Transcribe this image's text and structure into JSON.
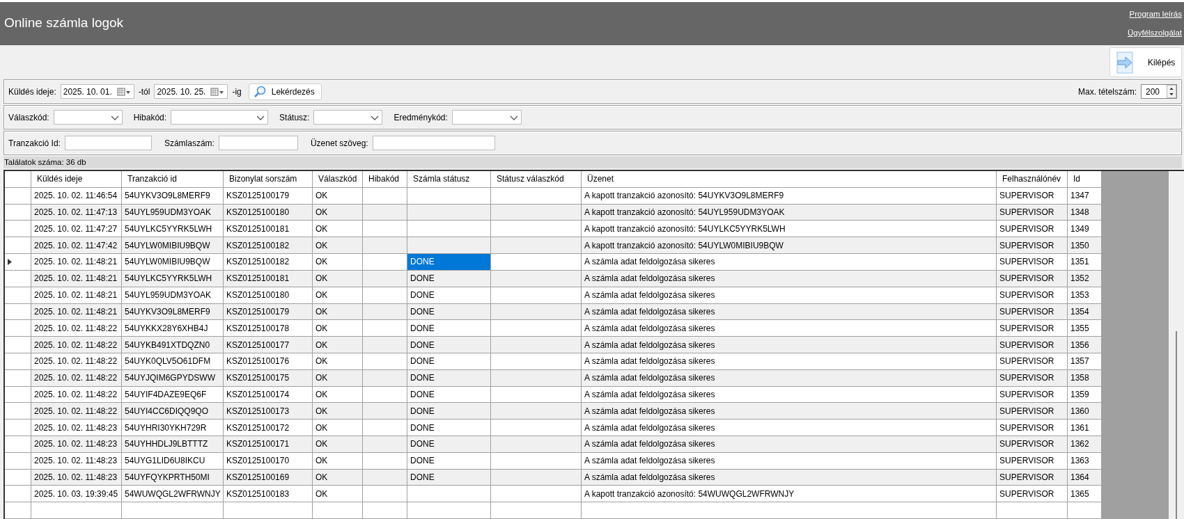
{
  "header": {
    "title": "Online számla logok",
    "links": [
      "Program leírás",
      "Ügyfélszolgálat"
    ]
  },
  "exit_button": {
    "label": "Kilépés"
  },
  "filters": {
    "sent_label": "Küldés ideje:",
    "date_from": "2025. 10. 01.",
    "from_suffix": "-tól",
    "date_to": "2025. 10. 25.",
    "to_suffix": "-ig",
    "query_button": "Lekérdezés",
    "max_label": "Max. tételszám:",
    "max_value": "200",
    "combos": [
      {
        "label": "Válaszkód:"
      },
      {
        "label": "Hibakód:"
      },
      {
        "label": "Státusz:"
      },
      {
        "label": "Eredménykód:"
      }
    ],
    "text_fields": [
      {
        "label": "Tranzakció Id:"
      },
      {
        "label": "Számlaszám:"
      },
      {
        "label": "Üzenet szöveg:"
      }
    ]
  },
  "result_count": "Találatok száma: 36 db",
  "table": {
    "columns": [
      "Küldés ideje",
      "Tranzakció id",
      "Bizonylat sorszám",
      "Válaszkód",
      "Hibakód",
      "Számla státusz",
      "Státusz válaszkód",
      "Üzenet",
      "Felhasználónév",
      "Id"
    ],
    "rows": [
      {
        "kuldes_ideje": "2025. 10. 02. 11:46:54",
        "tranzakcio_id": "54UYKV3O9L8MERF9",
        "bizonylat_sorszam": "KSZ0125100179",
        "valaszkod": "OK",
        "uzenet": "A kapott tranzakció azonosító: 54UYKV3O9L8MERF9",
        "felhasznalonev": "SUPERVISOR",
        "id": "1347",
        "selected": false
      },
      {
        "kuldes_ideje": "2025. 10. 02. 11:47:13",
        "tranzakcio_id": "54UYL959UDM3YOAK",
        "bizonylat_sorszam": "KSZ0125100180",
        "valaszkod": "OK",
        "uzenet": "A kapott tranzakció azonosító: 54UYL959UDM3YOAK",
        "felhasznalonev": "SUPERVISOR",
        "id": "1348",
        "selected": false
      },
      {
        "kuldes_ideje": "2025. 10. 02. 11:47:27",
        "tranzakcio_id": "54UYLKC5YYRK5LWH",
        "bizonylat_sorszam": "KSZ0125100181",
        "valaszkod": "OK",
        "uzenet": "A kapott tranzakció azonosító: 54UYLKC5YYRK5LWH",
        "felhasznalonev": "SUPERVISOR",
        "id": "1349",
        "selected": false
      },
      {
        "kuldes_ideje": "2025. 10. 02. 11:47:42",
        "tranzakcio_id": "54UYLW0MIBIU9BQW",
        "bizonylat_sorszam": "KSZ0125100182",
        "valaszkod": "OK",
        "uzenet": "A kapott tranzakció azonosító: 54UYLW0MIBIU9BQW",
        "felhasznalonev": "SUPERVISOR",
        "id": "1350",
        "selected": false
      },
      {
        "kuldes_ideje": "2025. 10. 02. 11:48:21",
        "tranzakcio_id": "54UYLW0MIBIU9BQW",
        "bizonylat_sorszam": "KSZ0125100182",
        "valaszkod": "OK",
        "szamla_statusz": "DONE",
        "uzenet": "A számla adat feldolgozása sikeres",
        "felhasznalonev": "SUPERVISOR",
        "id": "1351",
        "selected": true
      },
      {
        "kuldes_ideje": "2025. 10. 02. 11:48:21",
        "tranzakcio_id": "54UYLKC5YYRK5LWH",
        "bizonylat_sorszam": "KSZ0125100181",
        "valaszkod": "OK",
        "szamla_statusz": "DONE",
        "uzenet": "A számla adat feldolgozása sikeres",
        "felhasznalonev": "SUPERVISOR",
        "id": "1352",
        "selected": false
      },
      {
        "kuldes_ideje": "2025. 10. 02. 11:48:21",
        "tranzakcio_id": "54UYL959UDM3YOAK",
        "bizonylat_sorszam": "KSZ0125100180",
        "valaszkod": "OK",
        "szamla_statusz": "DONE",
        "uzenet": "A számla adat feldolgozása sikeres",
        "felhasznalonev": "SUPERVISOR",
        "id": "1353",
        "selected": false
      },
      {
        "kuldes_ideje": "2025. 10. 02. 11:48:21",
        "tranzakcio_id": "54UYKV3O9L8MERF9",
        "bizonylat_sorszam": "KSZ0125100179",
        "valaszkod": "OK",
        "szamla_statusz": "DONE",
        "uzenet": "A számla adat feldolgozása sikeres",
        "felhasznalonev": "SUPERVISOR",
        "id": "1354",
        "selected": false
      },
      {
        "kuldes_ideje": "2025. 10. 02. 11:48:22",
        "tranzakcio_id": "54UYKKX28Y6XHB4J",
        "bizonylat_sorszam": "KSZ0125100178",
        "valaszkod": "OK",
        "szamla_statusz": "DONE",
        "uzenet": "A számla adat feldolgozása sikeres",
        "felhasznalonev": "SUPERVISOR",
        "id": "1355",
        "selected": false
      },
      {
        "kuldes_ideje": "2025. 10. 02. 11:48:22",
        "tranzakcio_id": "54UYKB491XTDQZN0",
        "bizonylat_sorszam": "KSZ0125100177",
        "valaszkod": "OK",
        "szamla_statusz": "DONE",
        "uzenet": "A számla adat feldolgozása sikeres",
        "felhasznalonev": "SUPERVISOR",
        "id": "1356",
        "selected": false
      },
      {
        "kuldes_ideje": "2025. 10. 02. 11:48:22",
        "tranzakcio_id": "54UYK0QLV5O61DFM",
        "bizonylat_sorszam": "KSZ0125100176",
        "valaszkod": "OK",
        "szamla_statusz": "DONE",
        "uzenet": "A számla adat feldolgozása sikeres",
        "felhasznalonev": "SUPERVISOR",
        "id": "1357",
        "selected": false
      },
      {
        "kuldes_ideje": "2025. 10. 02. 11:48:22",
        "tranzakcio_id": "54UYJQIM6GPYDSWW",
        "bizonylat_sorszam": "KSZ0125100175",
        "valaszkod": "OK",
        "szamla_statusz": "DONE",
        "uzenet": "A számla adat feldolgozása sikeres",
        "felhasznalonev": "SUPERVISOR",
        "id": "1358",
        "selected": false
      },
      {
        "kuldes_ideje": "2025. 10. 02. 11:48:22",
        "tranzakcio_id": "54UYIF4DAZE9EQ6F",
        "bizonylat_sorszam": "KSZ0125100174",
        "valaszkod": "OK",
        "szamla_statusz": "DONE",
        "uzenet": "A számla adat feldolgozása sikeres",
        "felhasznalonev": "SUPERVISOR",
        "id": "1359",
        "selected": false
      },
      {
        "kuldes_ideje": "2025. 10. 02. 11:48:22",
        "tranzakcio_id": "54UYI4CC6DIQQ9QO",
        "bizonylat_sorszam": "KSZ0125100173",
        "valaszkod": "OK",
        "szamla_statusz": "DONE",
        "uzenet": "A számla adat feldolgozása sikeres",
        "felhasznalonev": "SUPERVISOR",
        "id": "1360",
        "selected": false
      },
      {
        "kuldes_ideje": "2025. 10. 02. 11:48:23",
        "tranzakcio_id": "54UYHRI30YKH729R",
        "bizonylat_sorszam": "KSZ0125100172",
        "valaszkod": "OK",
        "szamla_statusz": "DONE",
        "uzenet": "A számla adat feldolgozása sikeres",
        "felhasznalonev": "SUPERVISOR",
        "id": "1361",
        "selected": false
      },
      {
        "kuldes_ideje": "2025. 10. 02. 11:48:23",
        "tranzakcio_id": "54UYHHDLJ9LBTTTZ",
        "bizonylat_sorszam": "KSZ0125100171",
        "valaszkod": "OK",
        "szamla_statusz": "DONE",
        "uzenet": "A számla adat feldolgozása sikeres",
        "felhasznalonev": "SUPERVISOR",
        "id": "1362",
        "selected": false
      },
      {
        "kuldes_ideje": "2025. 10. 02. 11:48:23",
        "tranzakcio_id": "54UYG1LID6U8IKCU",
        "bizonylat_sorszam": "KSZ0125100170",
        "valaszkod": "OK",
        "szamla_statusz": "DONE",
        "uzenet": "A számla adat feldolgozása sikeres",
        "felhasznalonev": "SUPERVISOR",
        "id": "1363",
        "selected": false
      },
      {
        "kuldes_ideje": "2025. 10. 02. 11:48:23",
        "tranzakcio_id": "54UYFQYKPRTH50MI",
        "bizonylat_sorszam": "KSZ0125100169",
        "valaszkod": "OK",
        "szamla_statusz": "DONE",
        "uzenet": "A számla adat feldolgozása sikeres",
        "felhasznalonev": "SUPERVISOR",
        "id": "1364",
        "selected": false
      },
      {
        "kuldes_ideje": "2025. 10. 03. 19:39:45",
        "tranzakcio_id": "54WUWQGL2WFRWNJY",
        "bizonylat_sorszam": "KSZ0125100183",
        "valaszkod": "OK",
        "uzenet": "A kapott tranzakció azonosító: 54WUWQGL2WFRWNJY",
        "felhasznalonev": "SUPERVISOR",
        "id": "1365",
        "selected": false
      }
    ]
  }
}
